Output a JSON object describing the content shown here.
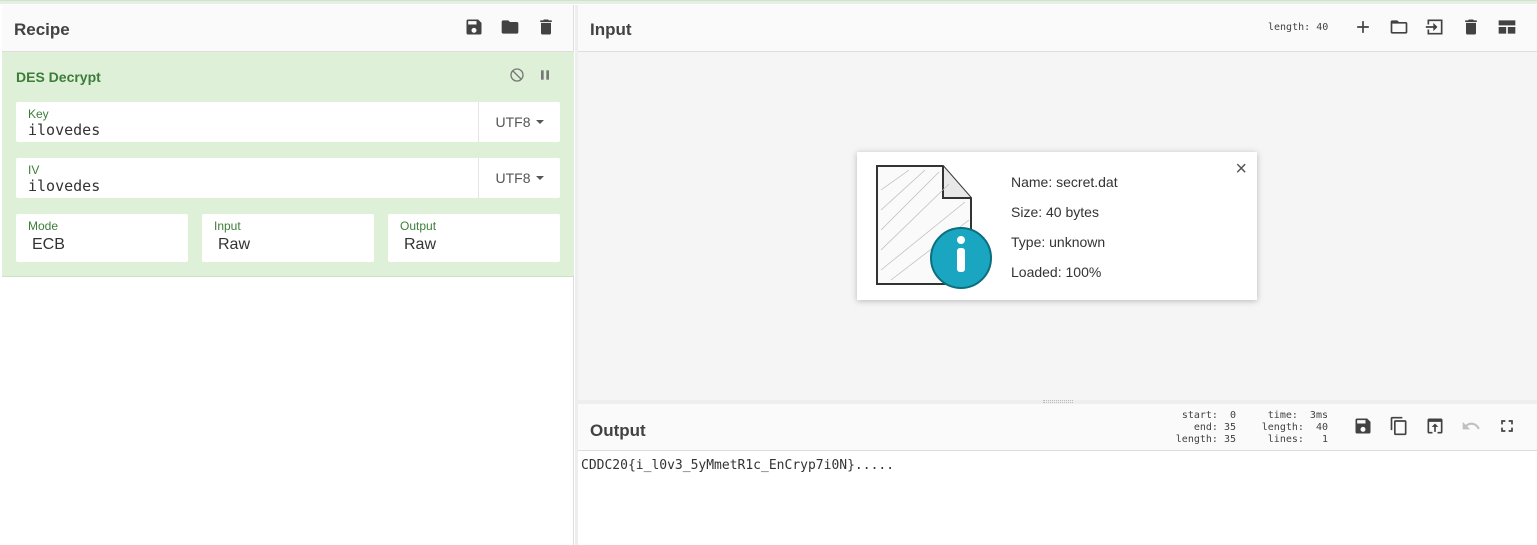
{
  "recipe": {
    "title": "Recipe",
    "operation": {
      "name": "DES Decrypt",
      "key": {
        "label": "Key",
        "value": "ilovedes",
        "encoding": "UTF8"
      },
      "iv": {
        "label": "IV",
        "value": "ilovedes",
        "encoding": "UTF8"
      },
      "mode": {
        "label": "Mode",
        "value": "ECB"
      },
      "input": {
        "label": "Input",
        "value": "Raw"
      },
      "output": {
        "label": "Output",
        "value": "Raw"
      }
    }
  },
  "input": {
    "title": "Input",
    "length_label": "length:",
    "length_value": "40",
    "file": {
      "name": "Name: secret.dat",
      "size": "Size: 40 bytes",
      "type": "Type: unknown",
      "loaded": "Loaded: 100%",
      "close": "×"
    }
  },
  "output": {
    "title": "Output",
    "stats": {
      "start": "start:  0",
      "end": "end: 35",
      "length": "length: 35",
      "time": "time:  3ms",
      "length2": "length:  40",
      "lines": "lines:   1"
    },
    "text": "CDDC20{i_l0v3_5yMmetR1c_EnCryp7i0N}....."
  },
  "icons": {
    "save": "save-icon",
    "open": "folder-icon",
    "delete": "trash-icon",
    "add": "plus-icon",
    "import": "import-icon",
    "layout": "layout-icon",
    "copy": "copy-icon",
    "replace": "replace-input-icon",
    "undo": "undo-icon",
    "maximise": "maximise-icon",
    "disable": "disable-icon",
    "breakpoint": "pause-icon",
    "info": "info-file-icon"
  },
  "colors": {
    "operation_bg": "#dff0d8",
    "operation_text": "#3d7d3a",
    "info_teal": "#1aa6c0"
  }
}
